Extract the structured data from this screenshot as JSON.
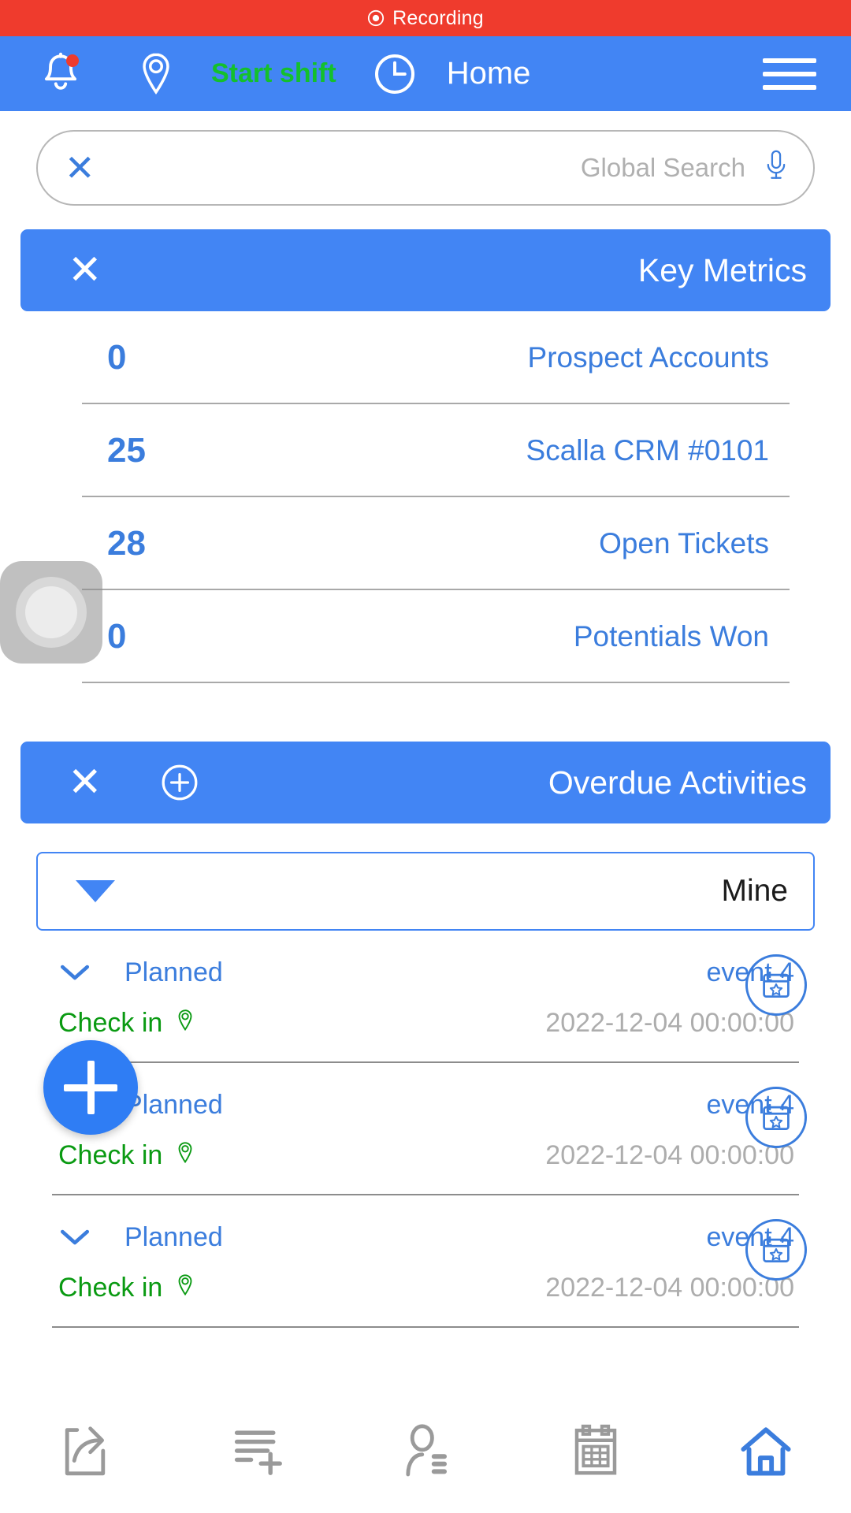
{
  "recording_banner": {
    "label": "Recording",
    "icon": "record-dot-icon",
    "bg_color": "#ef3b2d"
  },
  "appbar": {
    "bg_color": "#4285f4",
    "notification_icon": "bell-icon",
    "notification_badge": true,
    "location_icon": "location-pin-icon",
    "start_shift_label": "Start shift",
    "start_shift_color": "#14c02c",
    "clock_icon": "clock-icon",
    "title": "Home",
    "menu_icon": "hamburger-menu-icon"
  },
  "search": {
    "clear_label": "✕",
    "placeholder": "Global Search",
    "value": "",
    "mic_icon": "microphone-icon"
  },
  "key_metrics": {
    "title": "Key Metrics",
    "close_label": "✕",
    "rows": [
      {
        "value": "0",
        "label": "Prospect Accounts"
      },
      {
        "value": "25",
        "label": "Scalla CRM #0101"
      },
      {
        "value": "28",
        "label": "Open Tickets"
      },
      {
        "value": "0",
        "label": "Potentials Won"
      }
    ]
  },
  "overdue_activities": {
    "title": "Overdue Activities",
    "close_label": "✕",
    "add_icon": "plus-circle-icon",
    "filter": {
      "selected": "Mine",
      "caret_icon": "caret-down-icon"
    },
    "items": [
      {
        "status": "Planned",
        "subject": "event 4",
        "action_label": "Check in",
        "action_icon": "location-pin-icon",
        "date": "2022-12-04 00:00:00",
        "calendar_icon": "calendar-star-icon",
        "caret_icon": "chevron-down-icon"
      },
      {
        "status": "Planned",
        "subject": "event 4",
        "action_label": "Check in",
        "action_icon": "location-pin-icon",
        "date": "2022-12-04 00:00:00",
        "calendar_icon": "calendar-star-icon",
        "caret_icon": "chevron-down-icon"
      },
      {
        "status": "Planned",
        "subject": "event 4",
        "action_label": "Check in",
        "action_icon": "location-pin-icon",
        "date": "2022-12-04 00:00:00",
        "calendar_icon": "calendar-star-icon",
        "caret_icon": "chevron-down-icon"
      }
    ]
  },
  "fab": {
    "icon": "plus-icon",
    "color": "#2f7df4"
  },
  "recording_overlay": {
    "icon": "recording-floating-button-icon"
  },
  "bottom_nav": {
    "items": [
      {
        "icon": "share-export-icon"
      },
      {
        "icon": "list-add-icon"
      },
      {
        "icon": "contact-person-icon"
      },
      {
        "icon": "calendar-icon"
      },
      {
        "icon": "home-icon"
      }
    ],
    "active_index": 4,
    "active_color": "#3b7ddd",
    "inactive_color": "#9a9a9a"
  }
}
